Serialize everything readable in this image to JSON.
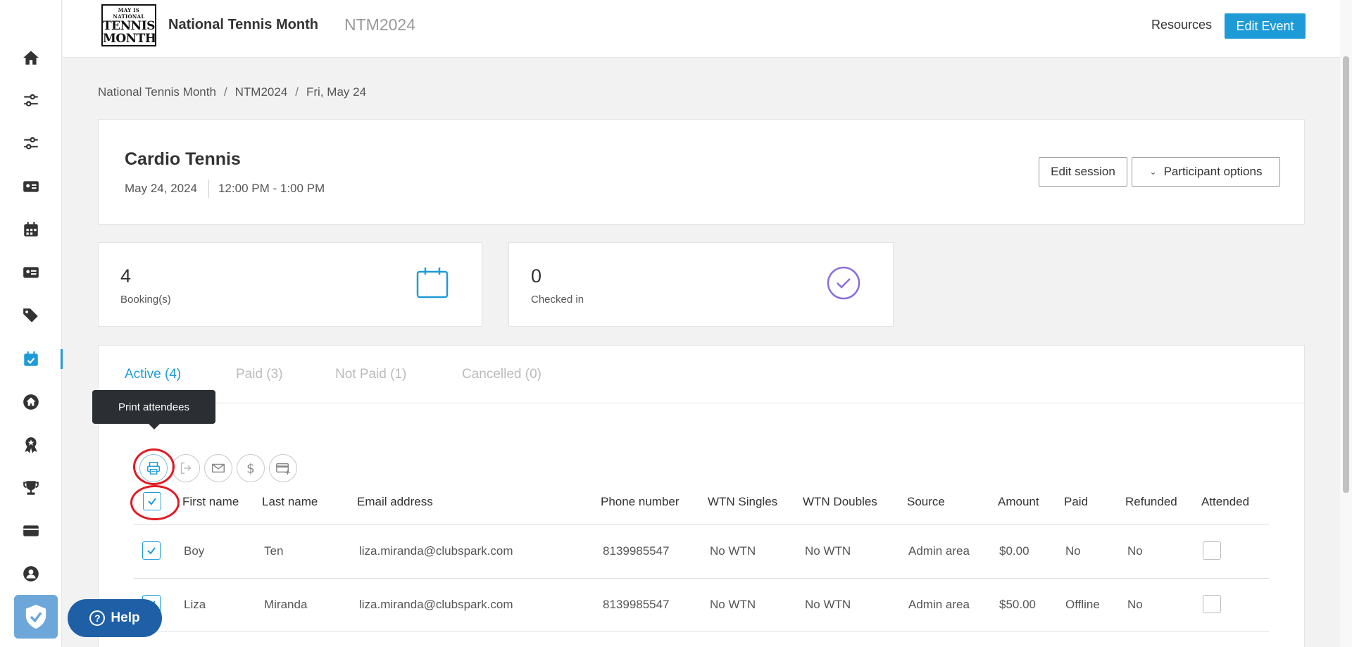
{
  "header": {
    "logo_small": "MAY IS NATIONAL",
    "logo_line1": "TENNIS",
    "logo_line2": "MONTH",
    "event_name": "National Tennis Month",
    "event_code": "NTM2024",
    "resources_label": "Resources",
    "edit_event_label": "Edit Event"
  },
  "sidebar": {
    "items": [
      "home-icon",
      "sliders-icon",
      "sliders-icon",
      "contact-card-icon",
      "calendar-icon",
      "id-card-icon",
      "tags-icon",
      "calendar-check-icon",
      "house-circle-icon",
      "award-icon",
      "trophy-icon",
      "ticket-icon",
      "user-circle-icon"
    ],
    "active_index": 7,
    "accent_color": "#1e9bd7"
  },
  "breadcrumb": {
    "items": [
      "National Tennis Month",
      "NTM2024",
      "Fri, May 24"
    ],
    "separator": "/"
  },
  "session": {
    "title": "Cardio Tennis",
    "date": "May 24, 2024",
    "time": "12:00 PM - 1:00 PM",
    "edit_session_label": "Edit session",
    "participant_options_label": "Participant options"
  },
  "stats": {
    "bookings": {
      "value": "4",
      "label": "Booking(s)",
      "icon": "calendar-icon"
    },
    "checked_in": {
      "value": "0",
      "label": "Checked in",
      "icon": "check-circle-icon"
    }
  },
  "tabs": [
    {
      "label": "Active (4)",
      "active": true
    },
    {
      "label": "Paid (3)",
      "active": false
    },
    {
      "label": "Not Paid (1)",
      "active": false
    },
    {
      "label": "Cancelled (0)",
      "active": false
    }
  ],
  "tooltip": "Print attendees",
  "actions": [
    "print-icon",
    "sign-out-icon",
    "email-icon",
    "dollar-icon",
    "add-card-icon"
  ],
  "table": {
    "columns": [
      "First name",
      "Last name",
      "Email address",
      "Phone number",
      "WTN Singles",
      "WTN Doubles",
      "Source",
      "Amount",
      "Paid",
      "Refunded",
      "Attended"
    ],
    "rows": [
      {
        "selected": true,
        "first": "Boy",
        "last": "Ten",
        "email": "liza.miranda@clubspark.com",
        "phone": "8139985547",
        "wtn_singles": "No WTN",
        "wtn_doubles": "No WTN",
        "source": "Admin area",
        "amount": "$0.00",
        "paid": "No",
        "refunded": "No",
        "attended": false
      },
      {
        "selected": true,
        "first": "Liza",
        "last": "Miranda",
        "email": "liza.miranda@clubspark.com",
        "phone": "8139985547",
        "wtn_singles": "No WTN",
        "wtn_doubles": "No WTN",
        "source": "Admin area",
        "amount": "$50.00",
        "paid": "Offline",
        "refunded": "No",
        "attended": false
      }
    ]
  },
  "help_label": "Help",
  "colors": {
    "primary": "#1e9bd7",
    "highlight": "#e01b24",
    "tooltip_bg": "#2b2f33",
    "help_bg": "#1f5fa6"
  }
}
